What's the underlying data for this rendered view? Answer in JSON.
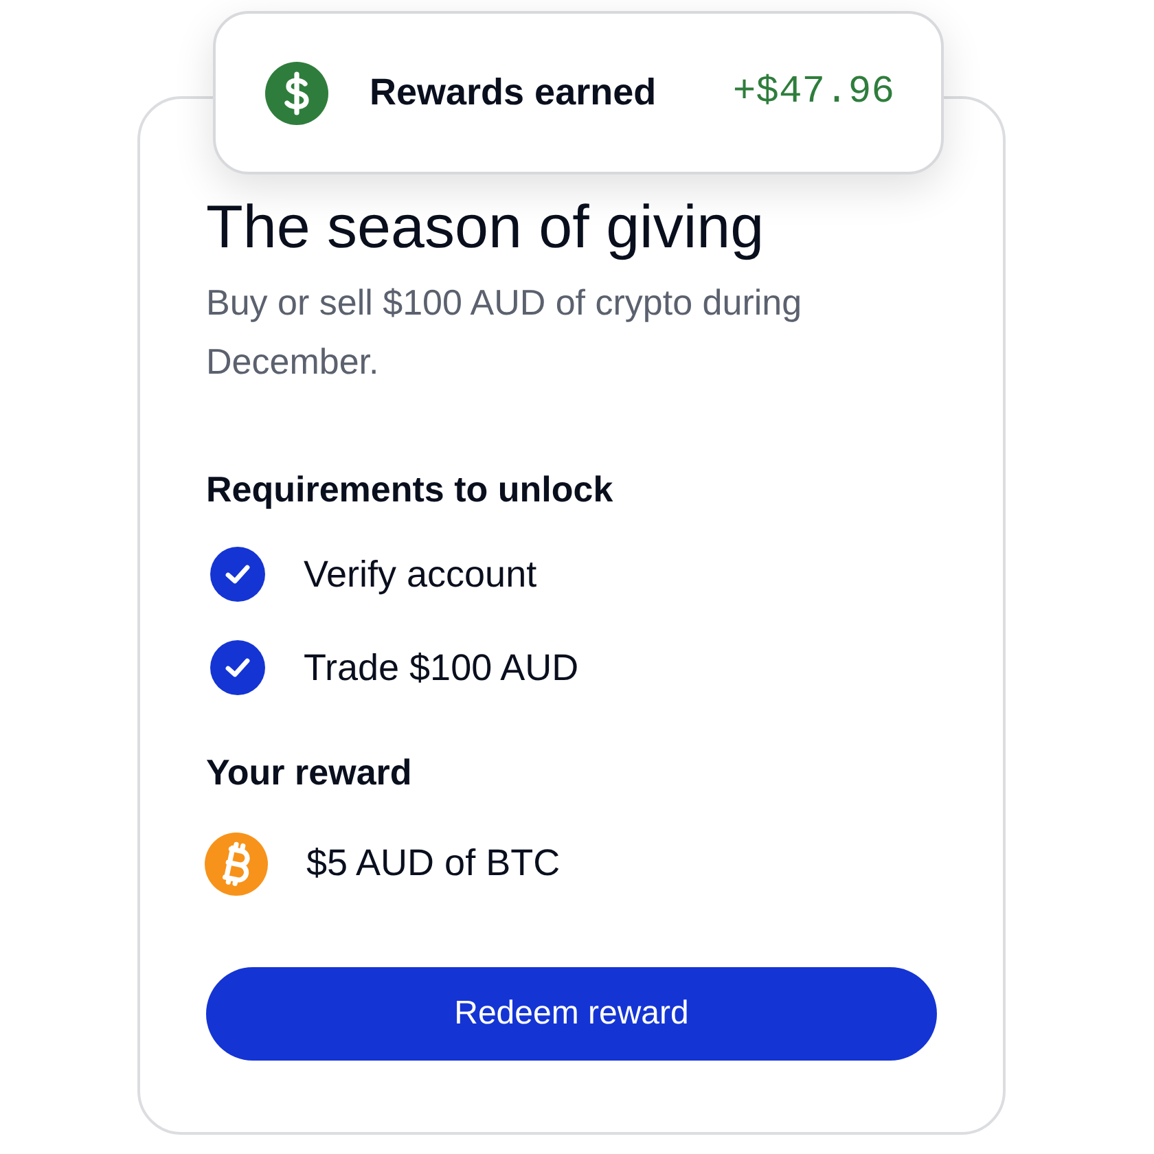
{
  "earned_banner": {
    "label": "Rewards earned",
    "amount": "+$47.96"
  },
  "card": {
    "title": "The season of giving",
    "description": "Buy or sell $100 AUD of crypto during December.",
    "requirements_heading": "Requirements to unlock",
    "requirements": [
      {
        "label": "Verify account",
        "checked": true
      },
      {
        "label": "Trade $100 AUD",
        "checked": true
      }
    ],
    "reward_heading": "Your reward",
    "reward": {
      "label": "$5 AUD of BTC"
    },
    "button": "Redeem reward"
  }
}
